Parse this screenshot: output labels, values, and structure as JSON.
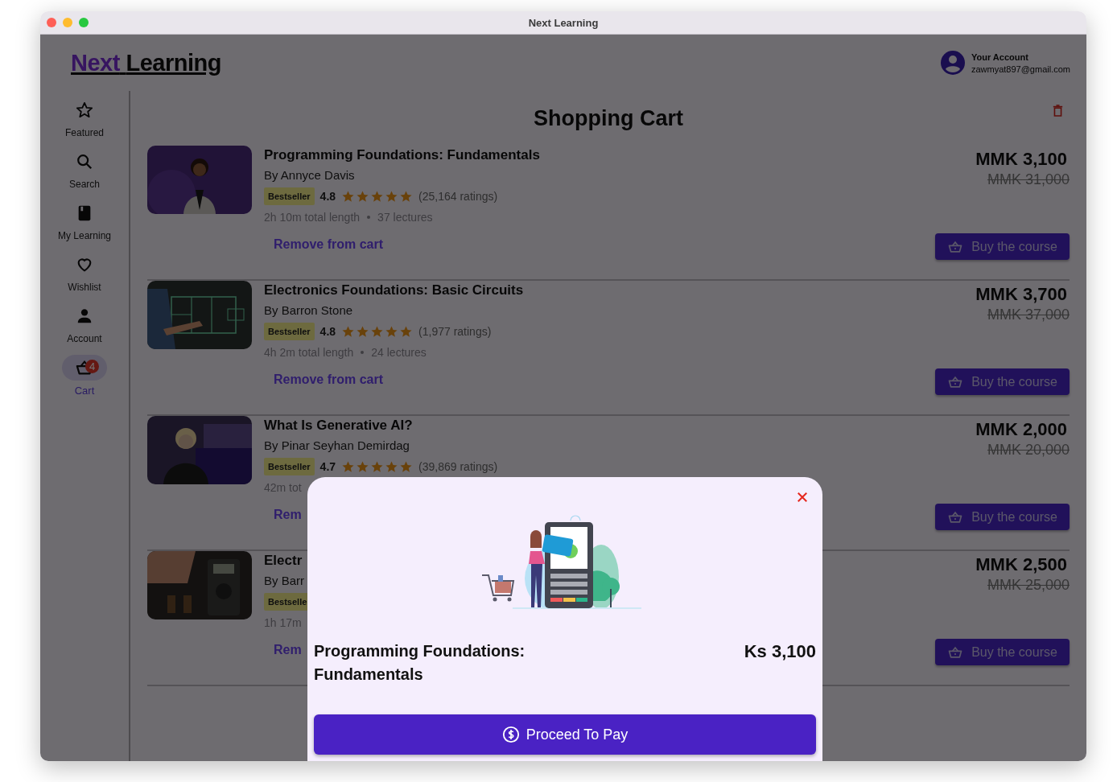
{
  "window": {
    "title": "Next Learning"
  },
  "header": {
    "logo": {
      "part_1": "Next",
      "part_2": "Learning"
    },
    "account": {
      "label": "Your Account",
      "email": "zawmyat897@gmail.com"
    }
  },
  "sidebar": {
    "items": [
      {
        "kind": "star",
        "label": "Featured",
        "selected": false
      },
      {
        "kind": "search",
        "label": "Search",
        "selected": false
      },
      {
        "kind": "book",
        "label": "My Learning",
        "selected": false
      },
      {
        "kind": "heart",
        "label": "Wishlist",
        "selected": false
      },
      {
        "kind": "person",
        "label": "Account",
        "selected": false
      },
      {
        "kind": "cart",
        "label": "Cart",
        "selected": true,
        "badge": "4"
      }
    ]
  },
  "page": {
    "title": "Shopping Cart"
  },
  "courses": [
    {
      "title": "Programming Foundations: Fundamentals",
      "author": "By Annyce Davis",
      "badge": "Bestseller",
      "rating": "4.8",
      "stars": 5,
      "ratings_count": "(25,164 ratings)",
      "length": "2h 10m total length",
      "lectures": "37 lectures",
      "remove_link": "Remove from cart",
      "price": "MMK 3,100",
      "original_price": "MMK 31,000",
      "buy_button": "Buy the course"
    },
    {
      "title": "Electronics Foundations: Basic Circuits",
      "author": "By Barron Stone",
      "badge": "Bestseller",
      "rating": "4.8",
      "stars": 5,
      "ratings_count": "(1,977 ratings)",
      "length": "4h 2m total length",
      "lectures": "24 lectures",
      "remove_link": "Remove from cart",
      "price": "MMK 3,700",
      "original_price": "MMK 37,000",
      "buy_button": "Buy the course"
    },
    {
      "title": "What Is Generative AI?",
      "author": "By Pinar Seyhan Demirdag",
      "badge": "Bestseller",
      "rating": "4.7",
      "stars": 5,
      "ratings_count": "(39,869 ratings)",
      "length": "42m tot",
      "remove_link": "Rem",
      "price": "MMK 2,000",
      "original_price": "MMK 20,000",
      "buy_button": "Buy the course"
    },
    {
      "title": "Electr",
      "author": "By Barr",
      "badge": "Bestselle",
      "length": "1h 17m",
      "remove_link": "Rem",
      "price": "MMK 2,500",
      "original_price": "MMK 25,000",
      "buy_button": "Buy the course"
    }
  ],
  "modal": {
    "item_title": "Programming Foundations: Fundamentals",
    "price": "Ks 3,100",
    "pay_button": "Proceed To Pay"
  }
}
